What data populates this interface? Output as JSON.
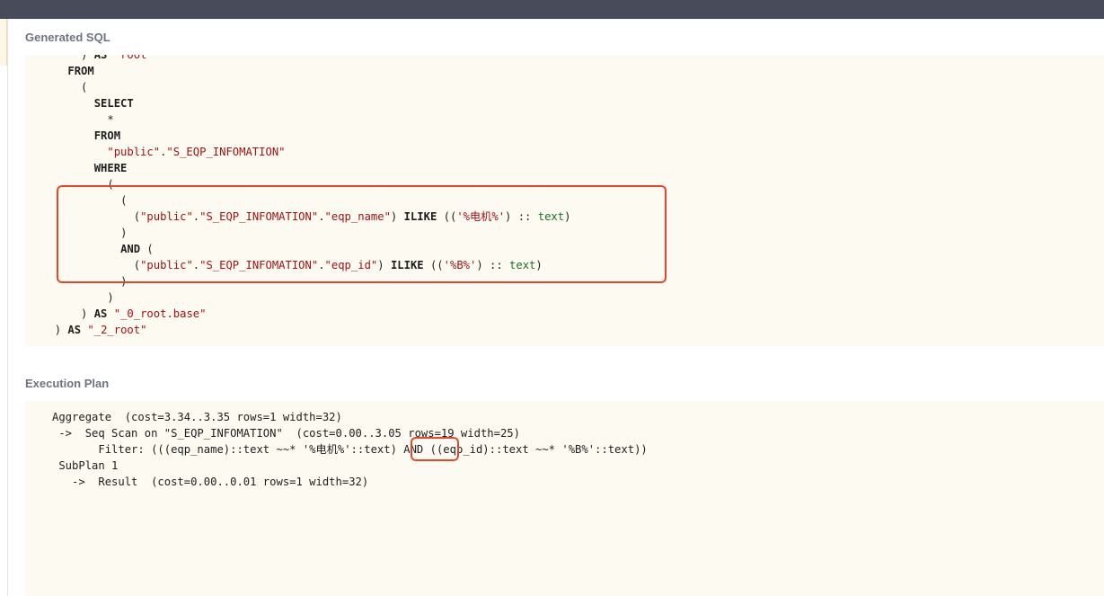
{
  "sections": {
    "sql_title": "Generated SQL",
    "plan_title": "Execution Plan"
  },
  "sql_lines": [
    {
      "indent": "      ",
      "tokens": [
        {
          "t": "p",
          "v": ") "
        },
        {
          "t": "kw",
          "v": "AS"
        },
        {
          "t": "p",
          "v": " "
        },
        {
          "t": "str",
          "v": "\"root\""
        }
      ]
    },
    {
      "indent": "    ",
      "tokens": [
        {
          "t": "kw",
          "v": "FROM"
        }
      ]
    },
    {
      "indent": "      ",
      "tokens": [
        {
          "t": "p",
          "v": "("
        }
      ]
    },
    {
      "indent": "        ",
      "tokens": [
        {
          "t": "kw",
          "v": "SELECT"
        }
      ]
    },
    {
      "indent": "          ",
      "tokens": [
        {
          "t": "p",
          "v": "*"
        }
      ]
    },
    {
      "indent": "        ",
      "tokens": [
        {
          "t": "kw",
          "v": "FROM"
        }
      ]
    },
    {
      "indent": "          ",
      "tokens": [
        {
          "t": "str",
          "v": "\"public\""
        },
        {
          "t": "p",
          "v": "."
        },
        {
          "t": "str",
          "v": "\"S_EQP_INFOMATION\""
        }
      ]
    },
    {
      "indent": "        ",
      "tokens": [
        {
          "t": "kw",
          "v": "WHERE"
        }
      ]
    },
    {
      "indent": "          ",
      "tokens": [
        {
          "t": "p",
          "v": "("
        }
      ]
    },
    {
      "indent": "            ",
      "tokens": [
        {
          "t": "p",
          "v": "("
        }
      ]
    },
    {
      "indent": "              ",
      "tokens": [
        {
          "t": "p",
          "v": "("
        },
        {
          "t": "str",
          "v": "\"public\""
        },
        {
          "t": "p",
          "v": "."
        },
        {
          "t": "str",
          "v": "\"S_EQP_INFOMATION\""
        },
        {
          "t": "p",
          "v": "."
        },
        {
          "t": "str",
          "v": "\"eqp_name\""
        },
        {
          "t": "p",
          "v": ") "
        },
        {
          "t": "kw",
          "v": "ILIKE"
        },
        {
          "t": "p",
          "v": " (("
        },
        {
          "t": "str",
          "v": "'%电机%'"
        },
        {
          "t": "p",
          "v": ") :: "
        },
        {
          "t": "typ",
          "v": "text"
        },
        {
          "t": "p",
          "v": ")"
        }
      ]
    },
    {
      "indent": "            ",
      "tokens": [
        {
          "t": "p",
          "v": ")"
        }
      ]
    },
    {
      "indent": "            ",
      "tokens": [
        {
          "t": "kw",
          "v": "AND"
        },
        {
          "t": "p",
          "v": " ("
        }
      ]
    },
    {
      "indent": "              ",
      "tokens": [
        {
          "t": "p",
          "v": "("
        },
        {
          "t": "str",
          "v": "\"public\""
        },
        {
          "t": "p",
          "v": "."
        },
        {
          "t": "str",
          "v": "\"S_EQP_INFOMATION\""
        },
        {
          "t": "p",
          "v": "."
        },
        {
          "t": "str",
          "v": "\"eqp_id\""
        },
        {
          "t": "p",
          "v": ") "
        },
        {
          "t": "kw",
          "v": "ILIKE"
        },
        {
          "t": "p",
          "v": " (("
        },
        {
          "t": "str",
          "v": "'%B%'"
        },
        {
          "t": "p",
          "v": ") :: "
        },
        {
          "t": "typ",
          "v": "text"
        },
        {
          "t": "p",
          "v": ")"
        }
      ]
    },
    {
      "indent": "            ",
      "tokens": [
        {
          "t": "p",
          "v": ")"
        }
      ]
    },
    {
      "indent": "          ",
      "tokens": [
        {
          "t": "p",
          "v": ")"
        }
      ]
    },
    {
      "indent": "      ",
      "tokens": [
        {
          "t": "p",
          "v": ") "
        },
        {
          "t": "kw",
          "v": "AS"
        },
        {
          "t": "p",
          "v": " "
        },
        {
          "t": "str",
          "v": "\"_0_root.base\""
        }
      ]
    },
    {
      "indent": "  ",
      "tokens": [
        {
          "t": "p",
          "v": ") "
        },
        {
          "t": "kw",
          "v": "AS"
        },
        {
          "t": "p",
          "v": " "
        },
        {
          "t": "str",
          "v": "\"_2_root\""
        }
      ]
    }
  ],
  "plan_lines": [
    "   Aggregate  (cost=3.34..3.35 rows=1 width=32)",
    "    ->  Seq Scan on \"S_EQP_INFOMATION\"  (cost=0.00..3.05 rows=19 width=25)",
    "          Filter: (((eqp_name)::text ~~* '%电机%'::text) AND ((eqp_id)::text ~~* '%B%'::text))",
    "    SubPlan 1",
    "      ->  Result  (cost=0.00..0.01 rows=1 width=32)"
  ],
  "highlight_color": "#e8462c"
}
